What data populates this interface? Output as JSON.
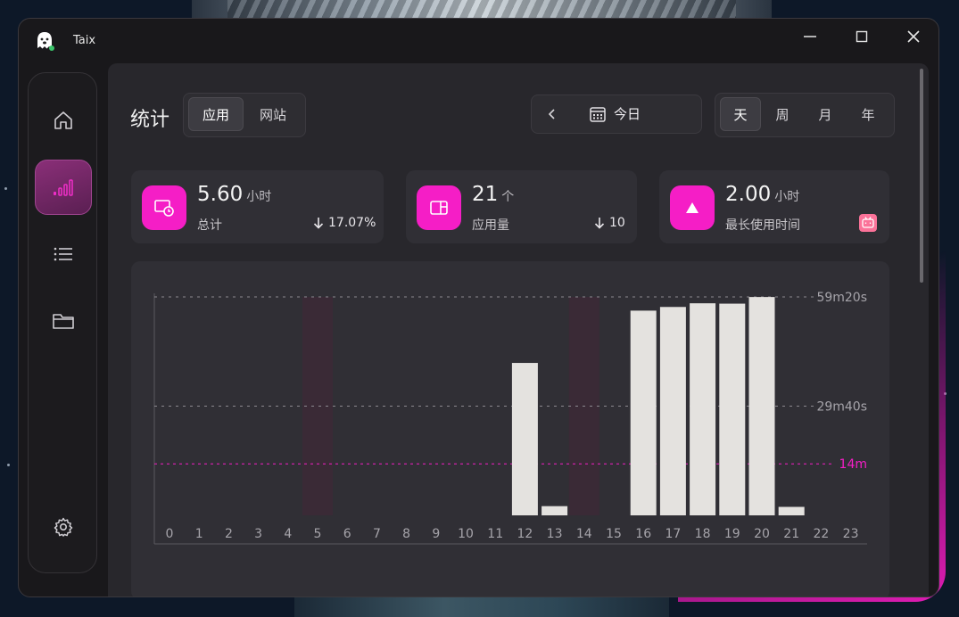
{
  "window": {
    "title": "Taix"
  },
  "header": {
    "title": "统计",
    "type_tabs": [
      {
        "label": "应用",
        "active": true
      },
      {
        "label": "网站",
        "active": false
      }
    ],
    "date_label": "今日",
    "range_tabs": [
      {
        "label": "天",
        "active": true
      },
      {
        "label": "周",
        "active": false
      },
      {
        "label": "月",
        "active": false
      },
      {
        "label": "年",
        "active": false
      }
    ]
  },
  "sidebar": {
    "items": [
      {
        "name": "home",
        "icon": "home-icon"
      },
      {
        "name": "statistics",
        "icon": "bar-signal-icon",
        "active": true
      },
      {
        "name": "list",
        "icon": "list-icon"
      },
      {
        "name": "folder",
        "icon": "folder-icon"
      },
      {
        "name": "settings",
        "icon": "gear-icon"
      }
    ]
  },
  "cards": [
    {
      "value": "5.60",
      "unit": "小时",
      "label": "总计",
      "delta": "17.07%",
      "delta_direction": "down",
      "icon": "clock-screen-icon"
    },
    {
      "value": "21",
      "unit": "个",
      "label": "应用量",
      "delta": "10",
      "delta_direction": "down",
      "icon": "app-window-icon"
    },
    {
      "value": "2.00",
      "unit": "小时",
      "label": "最长使用时间",
      "icon": "triangle-icon",
      "app_icon": "bilibili-icon"
    }
  ],
  "colors": {
    "accent": "#f51ec6",
    "bar": "#e4e2df",
    "highlight": "#3a2a36"
  },
  "chart_data": {
    "type": "bar",
    "categories": [
      "0",
      "1",
      "2",
      "3",
      "4",
      "5",
      "6",
      "7",
      "8",
      "9",
      "10",
      "11",
      "12",
      "13",
      "14",
      "15",
      "16",
      "17",
      "18",
      "19",
      "20",
      "21",
      "22",
      "23"
    ],
    "values": [
      0,
      0,
      0,
      0,
      0,
      0,
      0,
      0,
      0,
      0,
      0,
      0,
      41.4,
      2.5,
      0,
      0,
      55.6,
      56.6,
      57.6,
      57.5,
      59.3,
      2.3,
      0,
      0
    ],
    "y_unit": "minutes",
    "ylim": [
      0,
      59.33
    ],
    "grid_lines": [
      {
        "value": 59.33,
        "label": "59m20s"
      },
      {
        "value": 29.67,
        "label": "29m40s"
      }
    ],
    "average_line": {
      "value": 14,
      "label": "14m"
    },
    "highlight_categories": [
      "5",
      "14"
    ],
    "grid": true
  }
}
